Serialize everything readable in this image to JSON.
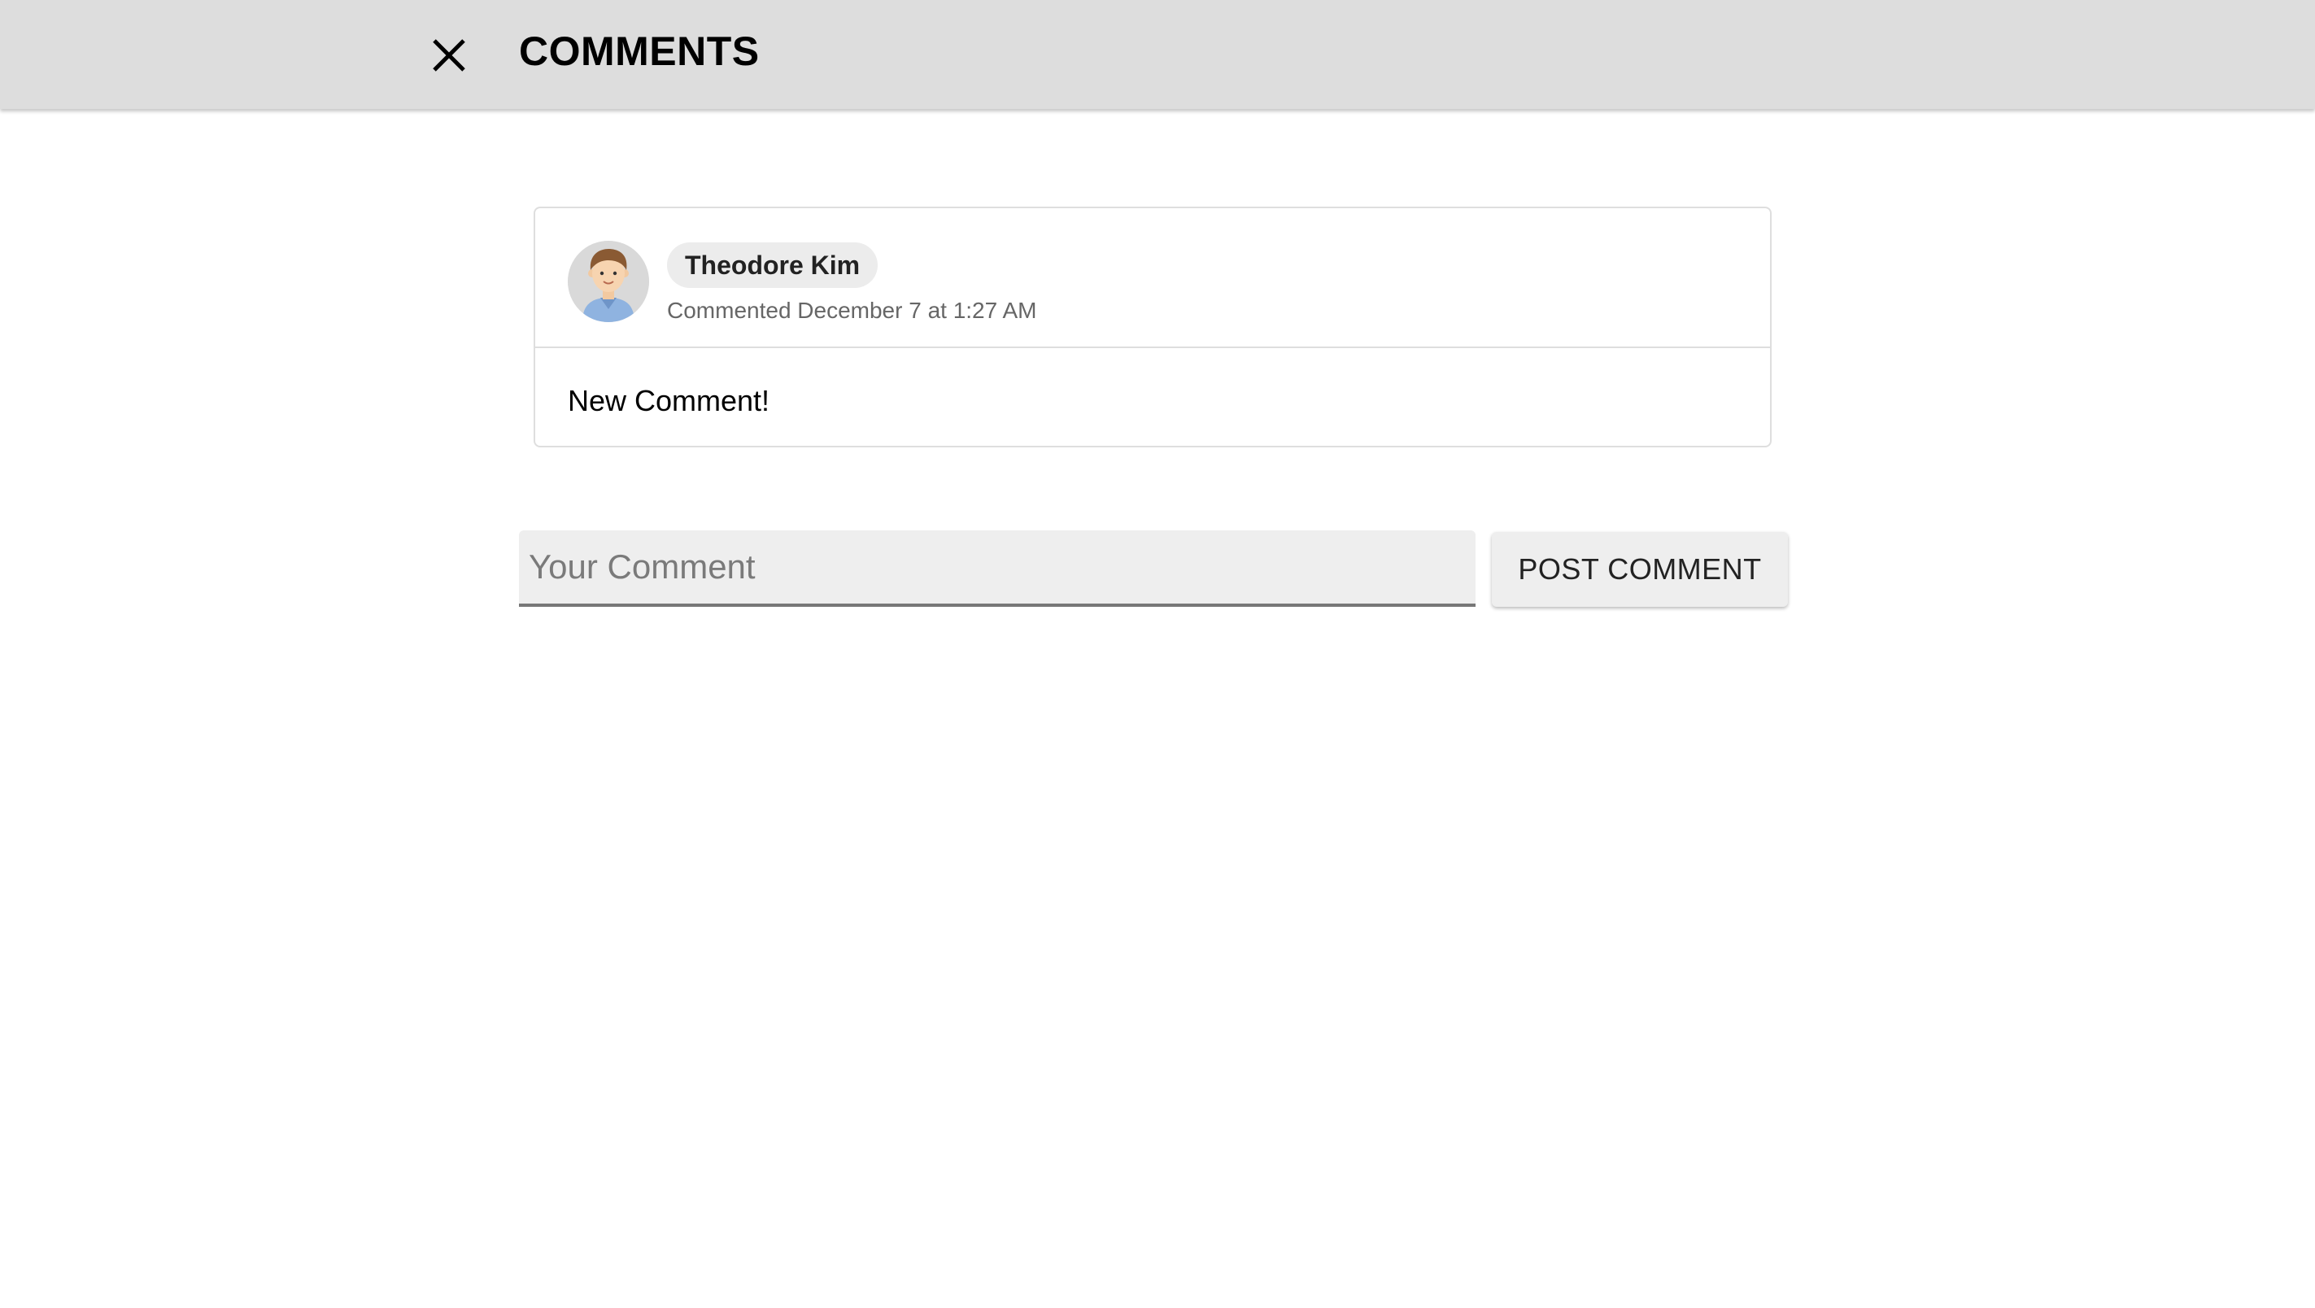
{
  "header": {
    "title": "COMMENTS",
    "close_icon": "close-icon"
  },
  "comments": [
    {
      "author": "Theodore Kim",
      "meta": "Commented December 7 at 1:27 AM",
      "text": "New Comment!",
      "avatar_icon": "boy-avatar-icon"
    }
  ],
  "composer": {
    "placeholder": "Your Comment",
    "value": "",
    "submit_label": "POST COMMENT"
  },
  "colors": {
    "header_bg": "#dddddd",
    "input_bg": "#eeeeee",
    "button_bg": "#eeeeee",
    "chip_bg": "#ececec",
    "card_border": "#dedede"
  }
}
